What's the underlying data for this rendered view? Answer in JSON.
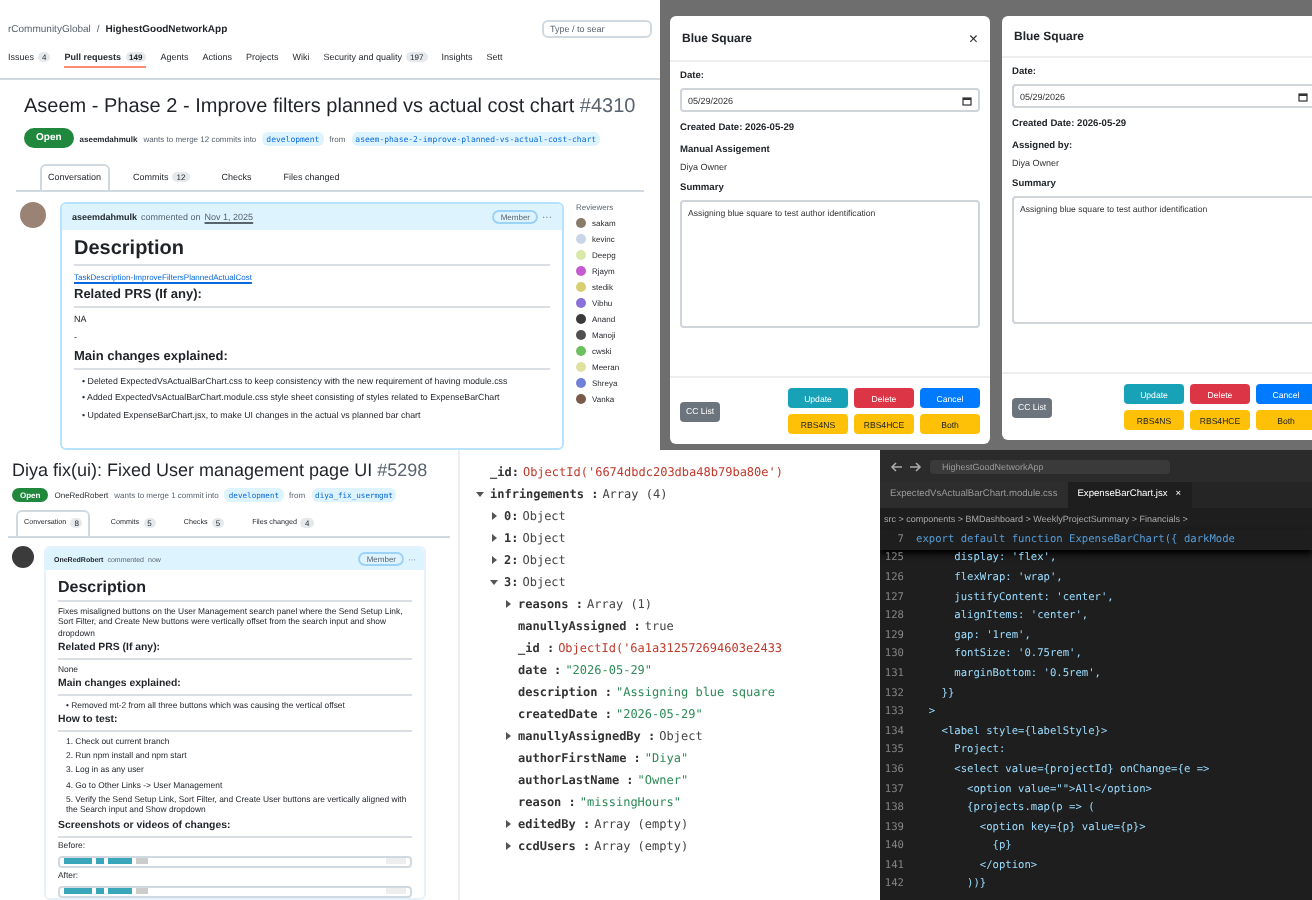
{
  "pr_page": {
    "breadcrumb": [
      "rCommunityGlobal",
      "/",
      "HighestGoodNetworkApp"
    ],
    "search": {
      "placeholder": "Type / to sear"
    },
    "nav": [
      {
        "label": "Issues",
        "count": "4",
        "selected": false
      },
      {
        "label": "Pull requests",
        "count": "149",
        "selected": true
      },
      {
        "label": "Agents",
        "selected": false
      },
      {
        "label": "Actions",
        "selected": false
      },
      {
        "label": "Projects",
        "selected": false
      },
      {
        "label": "Wiki",
        "selected": false
      },
      {
        "label": "Security and quality",
        "count": "197",
        "selected": false
      },
      {
        "label": "Insights",
        "selected": false
      },
      {
        "label": "Sett",
        "selected": false
      }
    ],
    "title": "Aseem - Phase 2 - Improve filters planned vs actual cost chart",
    "number": "#4310",
    "status": "Open",
    "meta": {
      "author": "aseemdahmulk",
      "text": "wants to merge 12 commits into",
      "base": "development",
      "from": "from",
      "head": "aseem-phase-2-improve-planned-vs-actual-cost-chart"
    },
    "tabs": [
      {
        "label": "Conversation",
        "selected": true
      },
      {
        "label": "Commits",
        "count": "12",
        "selected": false
      },
      {
        "label": "Checks",
        "selected": false
      },
      {
        "label": "Files changed",
        "selected": false
      }
    ],
    "comment": {
      "author": "aseemdahmulk",
      "action": "commented on",
      "date": "Nov 1, 2025",
      "role": "Member",
      "menu": "···"
    },
    "body": [
      {
        "kind": "heading",
        "text": "Description"
      },
      {
        "kind": "link",
        "text": "TaskDescription-ImproveFiltersPlannedActualCost"
      },
      {
        "kind": "subheading",
        "text": "Related PRS (If any):"
      },
      {
        "kind": "text",
        "text": "NA"
      },
      {
        "kind": "text",
        "text": "-"
      },
      {
        "kind": "subheading",
        "text": "Main changes explained:"
      },
      {
        "kind": "bullet",
        "marker": "•",
        "text": "Deleted ExpectedVsActualBarChart.css to keep consistency with the new requirement of having module.css"
      },
      {
        "kind": "bullet",
        "marker": "•",
        "text": "Added ExpectedVsActualBarChart.module.css style sheet consisting of styles related to ExpenseBarChart"
      },
      {
        "kind": "bullet",
        "marker": "•",
        "text": "Updated ExpenseBarChart.jsx, to make UI changes in the actual vs planned bar chart"
      }
    ],
    "reviewers": {
      "title": "Reviewers",
      "items": [
        {
          "name": "sakam",
          "color": "#8a7a6a"
        },
        {
          "name": "kevinc",
          "color": "#c9d6e8"
        },
        {
          "name": "Deepg",
          "color": "#d9e8a8"
        },
        {
          "name": "Rjaym",
          "color": "#c55bd0"
        },
        {
          "name": "stedik",
          "color": "#d8d070"
        },
        {
          "name": "Vibhu",
          "color": "#8a70d8"
        },
        {
          "name": "Anand",
          "color": "#3a3a3a"
        },
        {
          "name": "Manoji",
          "color": "#505050"
        },
        {
          "name": "cwski",
          "color": "#6cc060"
        },
        {
          "name": "Meeran",
          "color": "#e0e0a0"
        },
        {
          "name": "Shreya",
          "color": "#7080d8"
        },
        {
          "name": "Vanka",
          "color": "#7a5a4a"
        }
      ]
    }
  },
  "dialogs": [
    {
      "title": "Blue Square",
      "close": "×",
      "date_label": "Date:",
      "date_value": "05/29/2026",
      "created": "Created Date: 2026-05-29",
      "assign_label": "Manual Assigement",
      "assign_value": "Diya Owner",
      "summary_label": "Summary",
      "summary": "Assigning blue square to test author identification",
      "cc": "CC List",
      "buttons": [
        {
          "label": "Update",
          "kind": "info"
        },
        {
          "label": "Delete",
          "kind": "danger"
        },
        {
          "label": "Cancel",
          "kind": "primary"
        },
        {
          "label": "RBS4NS",
          "kind": "warning"
        },
        {
          "label": "RBS4HCE",
          "kind": "warning"
        },
        {
          "label": "Both",
          "kind": "warning"
        }
      ]
    },
    {
      "title": "Blue Square",
      "date_label": "Date:",
      "date_value": "05/29/2026",
      "created": "Created Date: 2026-05-29",
      "assign_label": "Assigned by:",
      "assign_value": "Diya Owner",
      "summary_label": "Summary",
      "summary": "Assigning blue square to test author identification",
      "cc": "CC List",
      "buttons": [
        {
          "label": "Update",
          "kind": "info"
        },
        {
          "label": "Delete",
          "kind": "danger"
        },
        {
          "label": "Cancel",
          "kind": "primary"
        },
        {
          "label": "RBS4NS",
          "kind": "warning"
        },
        {
          "label": "RBS4HCE",
          "kind": "warning"
        },
        {
          "label": "Both",
          "kind": "warning"
        }
      ]
    }
  ],
  "pr_page_2": {
    "title": "Diya fix(ui): Fixed User management page UI",
    "number": "#5298",
    "status": "Open",
    "meta": {
      "author": "OneRedRobert",
      "text": "wants to merge 1 commit into",
      "base": "development",
      "from": "from",
      "head": "diya_fix_usermgmt"
    },
    "tabs": [
      {
        "label": "Conversation",
        "count": "8",
        "selected": true
      },
      {
        "label": "Commits",
        "count": "5",
        "selected": false
      },
      {
        "label": "Checks",
        "count": "5",
        "selected": false
      },
      {
        "label": "Files changed",
        "count": "4",
        "selected": false
      }
    ],
    "comment": {
      "author": "OneRedRobert",
      "action": "commented",
      "date": "now",
      "role": "Member",
      "menu": "···"
    },
    "body": [
      {
        "kind": "heading",
        "text": "Description"
      },
      {
        "kind": "text",
        "text": "Fixes misaligned buttons on the User Management search panel where the Send Setup Link, Sort Filter, and Create New buttons were vertically offset from the search input and show dropdown"
      },
      {
        "kind": "subheading",
        "text": "Related PRS (If any):"
      },
      {
        "kind": "text",
        "text": "None"
      },
      {
        "kind": "subheading",
        "text": "Main changes explained:"
      },
      {
        "kind": "bullet",
        "marker": "•",
        "text": "Removed mt-2 from all three buttons which was causing the vertical offset"
      },
      {
        "kind": "subheading",
        "text": "How to test:"
      },
      {
        "kind": "step",
        "marker": "1.",
        "text": "Check out current branch"
      },
      {
        "kind": "step",
        "marker": "2.",
        "text": "Run npm install and npm start"
      },
      {
        "kind": "step",
        "marker": "3.",
        "text": "Log in as any user"
      },
      {
        "kind": "step",
        "marker": "4.",
        "text": "Go to Other Links -> User Management"
      },
      {
        "kind": "step",
        "marker": "5.",
        "text": "Verify the Send Setup Link, Sort Filter, and Create User buttons are vertically aligned with the Search input and Show dropdown"
      },
      {
        "kind": "subheading",
        "text": "Screenshots or videos of changes:"
      },
      {
        "kind": "caption",
        "text": "Before:"
      },
      {
        "kind": "shot"
      },
      {
        "kind": "caption",
        "text": "After:"
      },
      {
        "kind": "shot"
      }
    ]
  },
  "document_tree": [
    {
      "key": "_id:",
      "value": "ObjectId('6674dbdc203dba48b79ba80e')",
      "kind": "objectid"
    },
    {
      "key": "infringements :",
      "value": "Array (4)",
      "kind": "plain",
      "expanded": true,
      "children": [
        {
          "key": "0:",
          "value": "Object",
          "kind": "plain",
          "expanded": false
        },
        {
          "key": "1:",
          "value": "Object",
          "kind": "plain",
          "expanded": false
        },
        {
          "key": "2:",
          "value": "Object",
          "kind": "plain",
          "expanded": false
        },
        {
          "key": "3:",
          "value": "Object",
          "kind": "plain",
          "expanded": true,
          "children": [
            {
              "key": "reasons :",
              "value": "Array (1)",
              "kind": "plain",
              "expanded": false
            },
            {
              "key": "manullyAssigned :",
              "value": "true",
              "kind": "plain"
            },
            {
              "key": "_id :",
              "value": "ObjectId('6a1a312572694603e2433",
              "kind": "objectid"
            },
            {
              "key": "date :",
              "value": "\"2026-05-29\"",
              "kind": "string"
            },
            {
              "key": "description :",
              "value": "\"Assigning blue square",
              "kind": "string"
            },
            {
              "key": "createdDate :",
              "value": "\"2026-05-29\"",
              "kind": "string"
            },
            {
              "key": "manullyAssignedBy :",
              "value": "Object",
              "kind": "plain",
              "expanded": false
            },
            {
              "key": "authorFirstName :",
              "value": "\"Diya\"",
              "kind": "string"
            },
            {
              "key": "authorLastName :",
              "value": "\"Owner\"",
              "kind": "string"
            },
            {
              "key": "reason :",
              "value": "\"missingHours\"",
              "kind": "string"
            },
            {
              "key": "editedBy :",
              "value": "Array (empty)",
              "kind": "plain",
              "expanded": false
            },
            {
              "key": "ccdUsers :",
              "value": "Array (empty)",
              "kind": "plain",
              "expanded": false
            }
          ]
        }
      ]
    }
  ],
  "editor": {
    "address": "HighestGoodNetworkApp",
    "tabs": [
      {
        "label": "ExpectedVsActualBarChart.module.css",
        "selected": false
      },
      {
        "label": "ExpenseBarChart.jsx",
        "selected": true,
        "close": "×"
      }
    ],
    "breadcrumb": "src > components > BMDashboard > WeeklyProjectSummary > Financials >",
    "sticky": {
      "number": "7",
      "text": "export default function ExpenseBarChart({ darkMode"
    },
    "lines": [
      {
        "number": "125",
        "text": "      display: 'flex',"
      },
      {
        "number": "126",
        "text": "      flexWrap: 'wrap',"
      },
      {
        "number": "127",
        "text": "      justifyContent: 'center',"
      },
      {
        "number": "128",
        "text": "      alignItems: 'center',"
      },
      {
        "number": "129",
        "text": "      gap: '1rem',"
      },
      {
        "number": "130",
        "text": "      fontSize: '0.75rem',"
      },
      {
        "number": "131",
        "text": "      marginBottom: '0.5rem',"
      },
      {
        "number": "132",
        "text": "    }}"
      },
      {
        "number": "133",
        "text": "  >"
      },
      {
        "number": "134",
        "text": "    <label style={labelStyle}>"
      },
      {
        "number": "135",
        "text": "      Project:"
      },
      {
        "number": "136",
        "text": "      <select value={projectId} onChange={e =>"
      },
      {
        "number": "137",
        "text": "        <option value=\"\">All</option>"
      },
      {
        "number": "138",
        "text": "        {projects.map(p => ("
      },
      {
        "number": "139",
        "text": "          <option key={p} value={p}>"
      },
      {
        "number": "140",
        "text": "            {p}"
      },
      {
        "number": "141",
        "text": "          </option>"
      },
      {
        "number": "142",
        "text": "        ))}"
      }
    ]
  }
}
